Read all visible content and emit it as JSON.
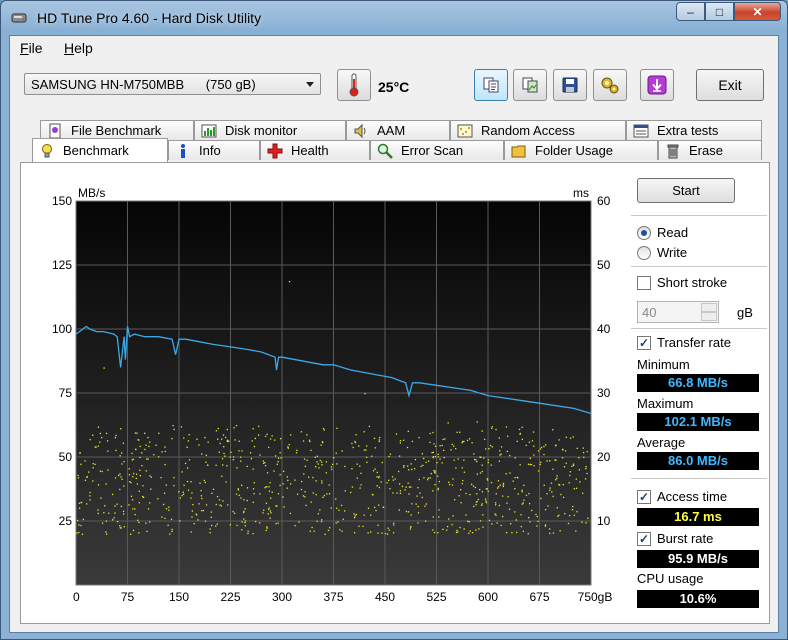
{
  "window": {
    "title": "HD Tune Pro 4.60 - Hard Disk Utility",
    "caption_min": "‒",
    "caption_max": "□",
    "caption_close": "✕"
  },
  "menu": [
    {
      "label": "File",
      "accel": "F",
      "rest": "ile"
    },
    {
      "label": "Help",
      "accel": "H",
      "rest": "elp"
    }
  ],
  "toolbar": {
    "drive": "SAMSUNG HN-M750MBB      (750 gB)",
    "temperature": "25°C",
    "exit_label": "Exit",
    "icons": [
      "copy-text-icon",
      "copy-image-icon",
      "save-icon",
      "options-icon",
      "download-icon"
    ]
  },
  "tabs_top": [
    {
      "label": "File Benchmark",
      "icon": "file-benchmark-icon"
    },
    {
      "label": "Disk monitor",
      "icon": "disk-monitor-icon"
    },
    {
      "label": "AAM",
      "icon": "speaker-icon"
    },
    {
      "label": "Random Access",
      "icon": "random-access-icon"
    },
    {
      "label": "Extra tests",
      "icon": "extra-tests-icon"
    }
  ],
  "tabs_bottom": [
    {
      "label": "Benchmark",
      "icon": "lightbulb-icon",
      "selected": true
    },
    {
      "label": "Info",
      "icon": "info-icon"
    },
    {
      "label": "Health",
      "icon": "health-cross-icon"
    },
    {
      "label": "Error Scan",
      "icon": "magnifier-icon"
    },
    {
      "label": "Folder Usage",
      "icon": "folder-icon"
    },
    {
      "label": "Erase",
      "icon": "trash-icon"
    }
  ],
  "side": {
    "start_label": "Start",
    "read_label": "Read",
    "write_label": "Write",
    "mode": "read",
    "short_stroke_label": "Short stroke",
    "short_stroke_checked": false,
    "short_stroke_value": "40",
    "short_stroke_unit": "gB",
    "transfer_rate_label": "Transfer rate",
    "transfer_rate_checked": true,
    "minimum_label": "Minimum",
    "minimum_value": "66.8 MB/s",
    "maximum_label": "Maximum",
    "maximum_value": "102.1 MB/s",
    "average_label": "Average",
    "average_value": "86.0 MB/s",
    "access_time_label": "Access time",
    "access_time_checked": true,
    "access_time_value": "16.7 ms",
    "burst_rate_label": "Burst rate",
    "burst_rate_checked": true,
    "burst_rate_value": "95.9 MB/s",
    "cpu_usage_label": "CPU usage",
    "cpu_usage_value": "10.6%"
  },
  "chart_data": {
    "type": "line",
    "xlabel": "",
    "ylabel": "MB/s",
    "y2label": "ms",
    "x_unit": "gB",
    "xlim": [
      0,
      750
    ],
    "ylim": [
      0,
      150
    ],
    "y2lim": [
      0,
      60
    ],
    "x_ticks": [
      "0",
      "75",
      "150",
      "225",
      "300",
      "375",
      "450",
      "525",
      "600",
      "675",
      "750gB"
    ],
    "y_ticks": [
      "150",
      "125",
      "100",
      "75",
      "50",
      "25"
    ],
    "y2_ticks": [
      "60",
      "50",
      "40",
      "30",
      "20",
      "10"
    ],
    "grid": true,
    "background": "#141414",
    "series": [
      {
        "kind": "transfer-rate-line",
        "color": "#3fa8e8",
        "x": [
          0,
          10,
          15,
          20,
          30,
          40,
          55,
          60,
          65,
          70,
          72,
          75,
          78,
          85,
          100,
          120,
          140,
          145,
          150,
          160,
          180,
          200,
          225,
          250,
          270,
          290,
          292,
          295,
          300,
          320,
          340,
          360,
          375,
          400,
          420,
          440,
          460,
          480,
          485,
          490,
          500,
          525,
          550,
          575,
          600,
          625,
          650,
          675,
          700,
          725,
          750
        ],
        "y": [
          98,
          100,
          101,
          100,
          99,
          99,
          98,
          97,
          85,
          97,
          88,
          101,
          97,
          98,
          97,
          97,
          96,
          90,
          96,
          96,
          95,
          94,
          93,
          92,
          91,
          89,
          84,
          89,
          89,
          88,
          87,
          86,
          86,
          84,
          83,
          82,
          81,
          79,
          74,
          79,
          79,
          78,
          77,
          76,
          74,
          73,
          72,
          71,
          70,
          69,
          67
        ]
      },
      {
        "kind": "access-time-scatter",
        "color": "#e8e830",
        "y_axis": "right",
        "distribution": "random access over full disk, 8–26 ms"
      }
    ]
  }
}
